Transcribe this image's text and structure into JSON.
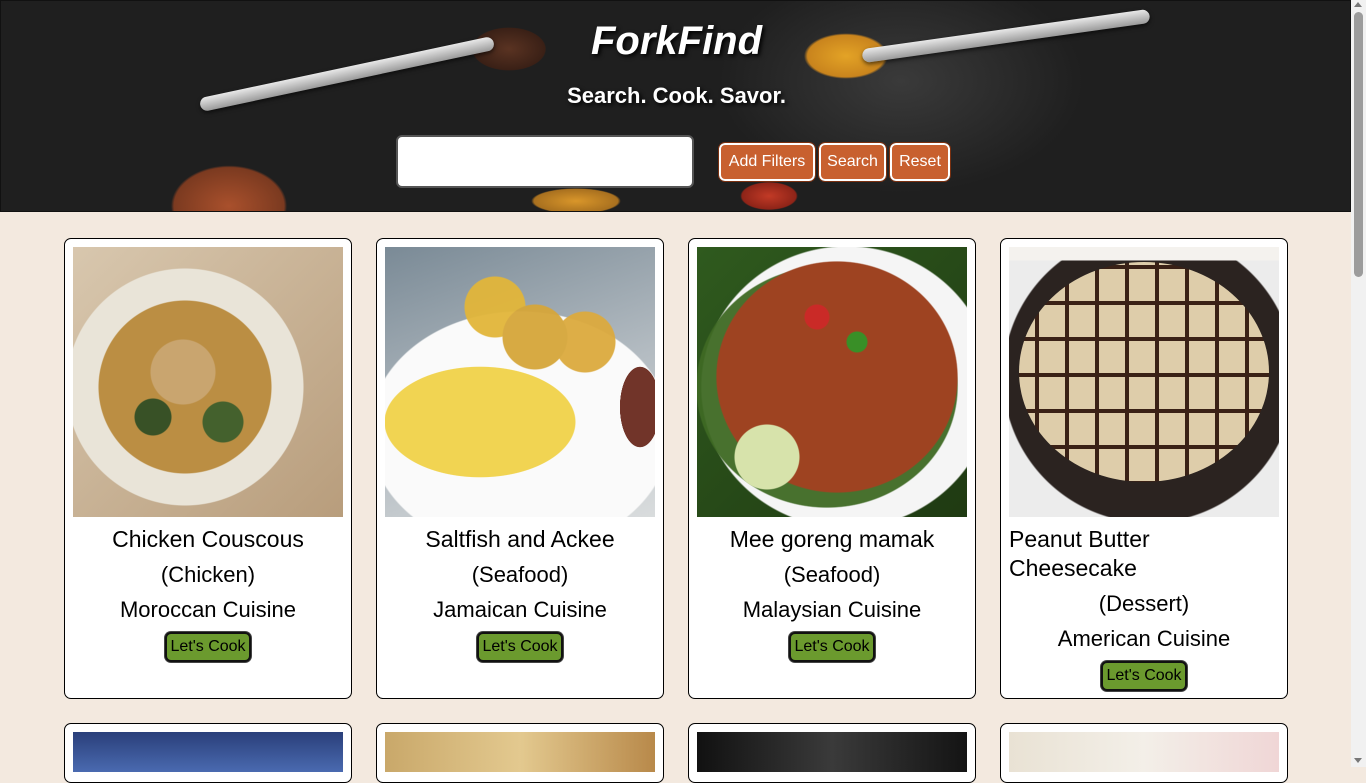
{
  "header": {
    "site_title": "ForkFind",
    "tagline": "Search. Cook. Savor.",
    "search": {
      "value": "",
      "placeholder": ""
    },
    "buttons": {
      "add_filters": "Add Filters",
      "search": "Search",
      "reset": "Reset"
    }
  },
  "recipes": [
    {
      "name": "Chicken Couscous",
      "category": "(Chicken)",
      "cuisine": "Moroccan Cuisine",
      "action": "Let's Cook"
    },
    {
      "name": "Saltfish and Ackee",
      "category": "(Seafood)",
      "cuisine": "Jamaican Cuisine",
      "action": "Let's Cook"
    },
    {
      "name": "Mee goreng mamak",
      "category": "(Seafood)",
      "cuisine": "Malaysian Cuisine",
      "action": "Let's Cook"
    },
    {
      "name": "Peanut Butter Cheesecake",
      "category": "(Dessert)",
      "cuisine": "American Cuisine",
      "action": "Let's Cook"
    }
  ],
  "colors": {
    "page_background": "#f3e9df",
    "header_button": "#c8602f",
    "cook_button": "#6b9a2e"
  },
  "icons": [
    "scroll-up-arrow-icon",
    "scroll-down-arrow-icon"
  ]
}
